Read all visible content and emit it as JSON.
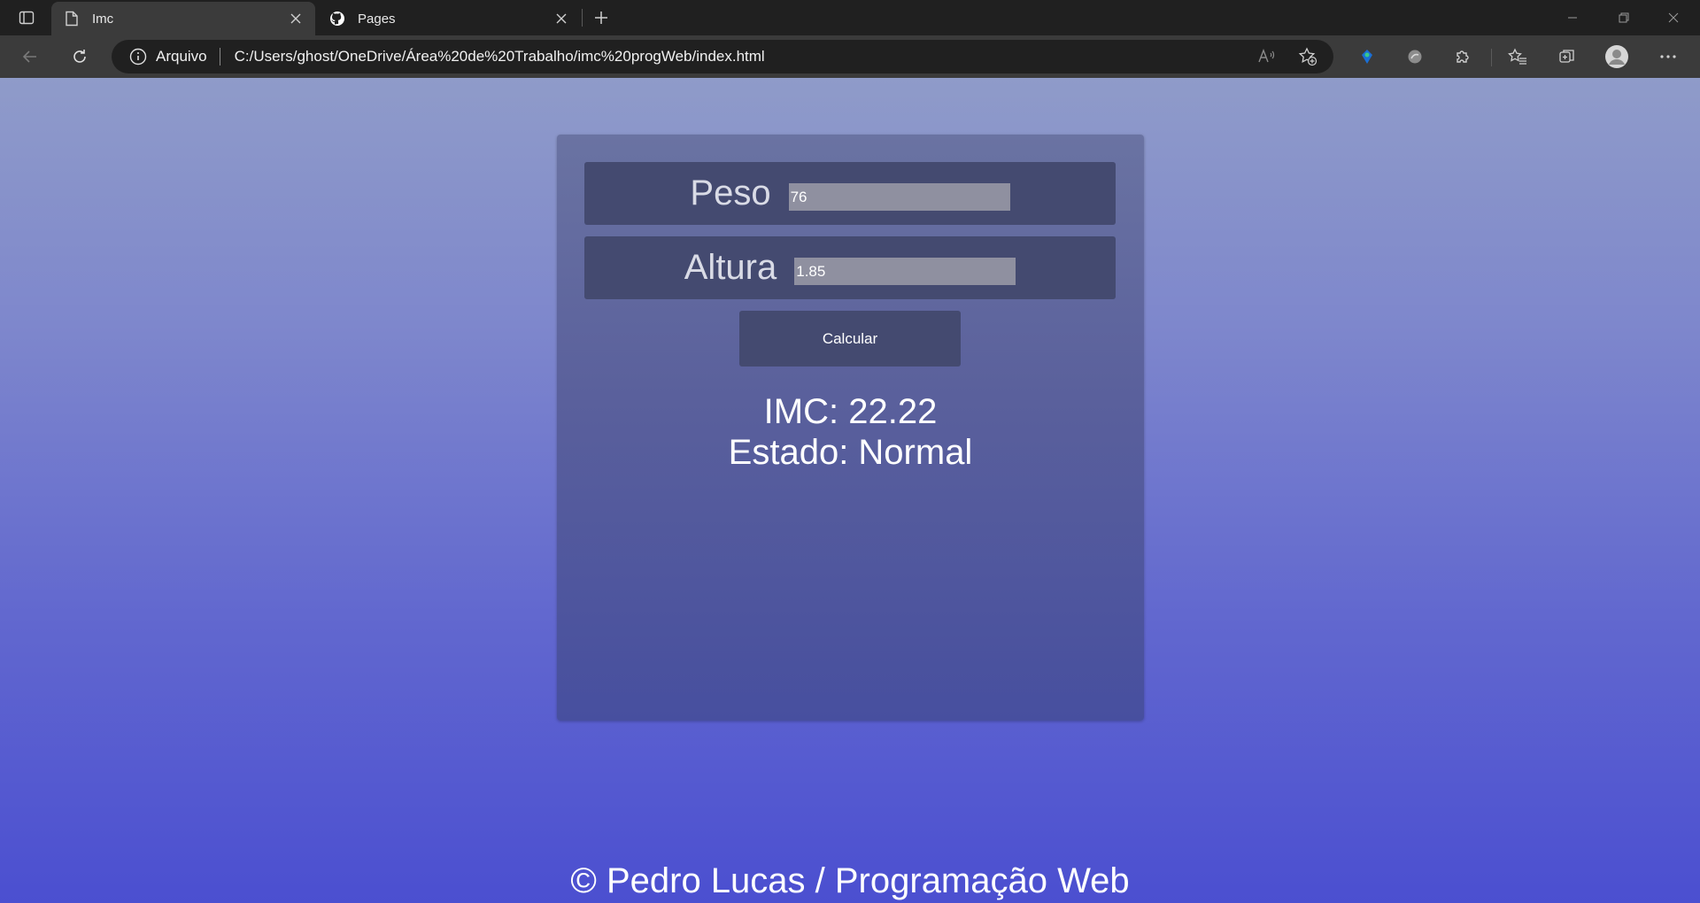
{
  "browser": {
    "tabs": [
      {
        "title": "Imc",
        "icon": "page-icon",
        "active": true
      },
      {
        "title": "Pages",
        "icon": "github-icon",
        "active": false
      }
    ],
    "address": {
      "site_label": "Arquivo",
      "url": "C:/Users/ghost/OneDrive/Área%20de%20Trabalho/imc%20progWeb/index.html"
    }
  },
  "page": {
    "form": {
      "peso_label": "Peso",
      "peso_value": "76",
      "altura_label": "Altura",
      "altura_value": "1.85",
      "button_label": "Calcular"
    },
    "result": {
      "imc_line": "IMC: 22.22",
      "estado_line": "Estado: Normal"
    },
    "footer": "© Pedro Lucas / Programação Web"
  }
}
